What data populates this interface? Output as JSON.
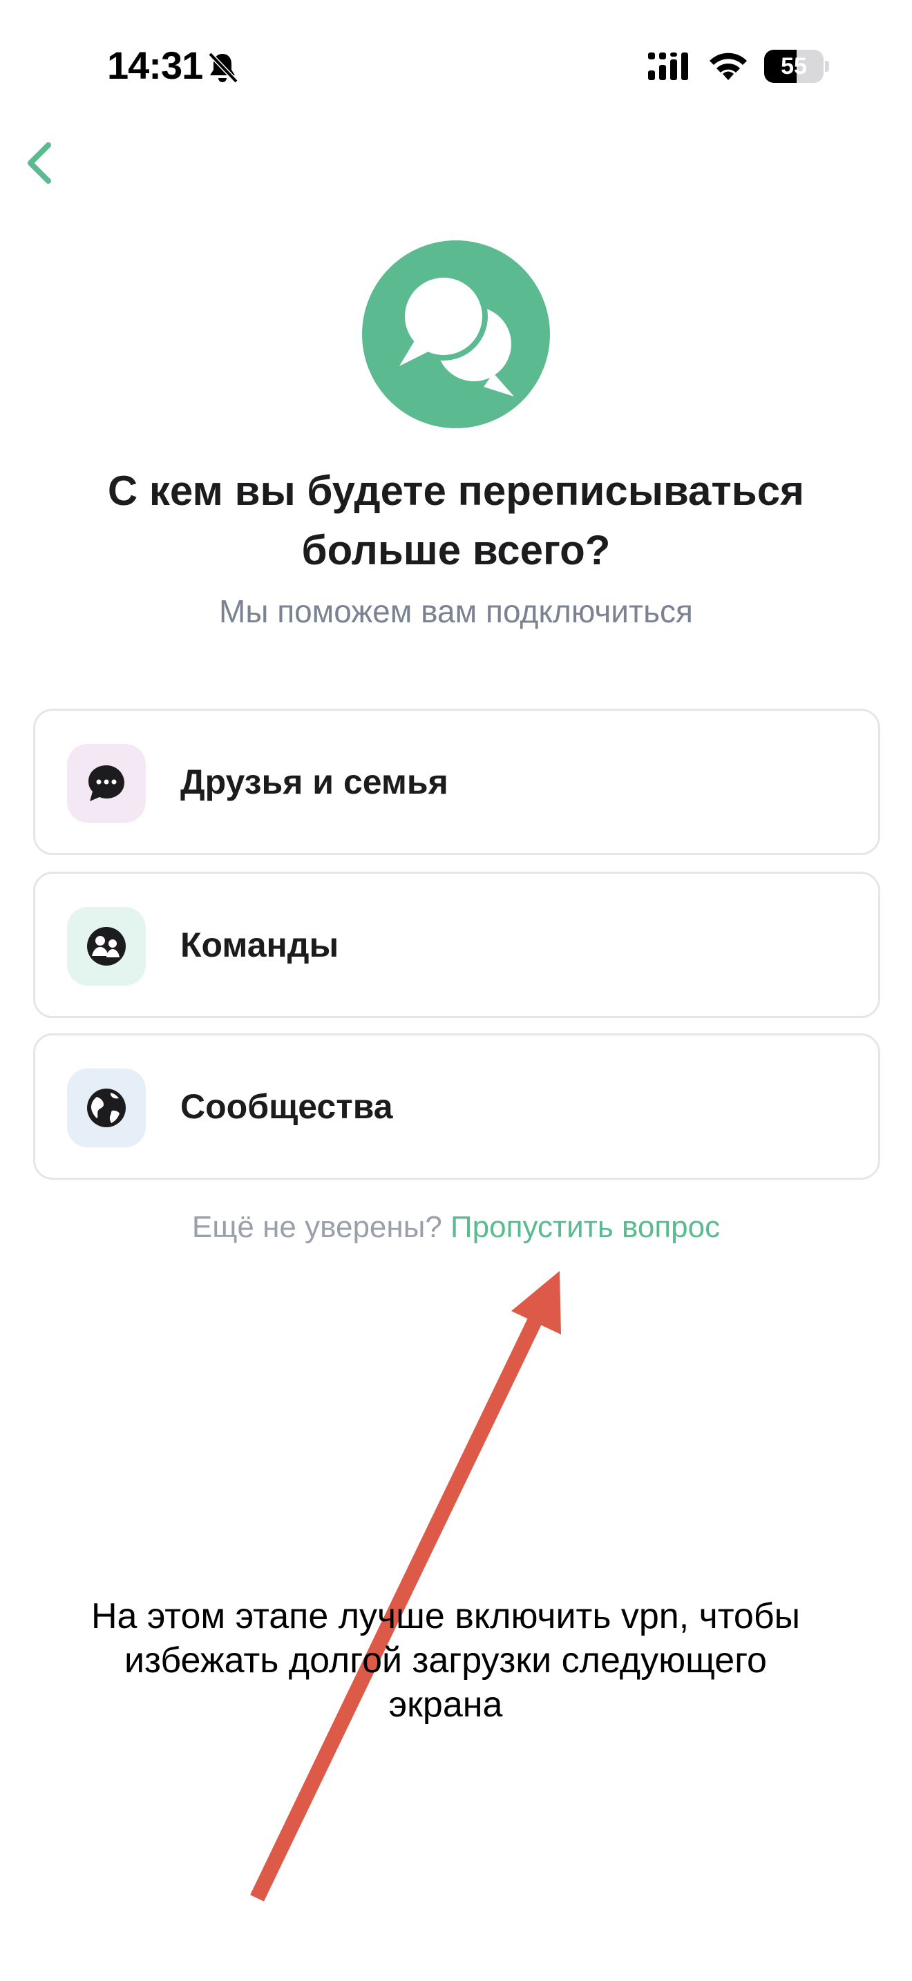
{
  "status": {
    "time": "14:31",
    "battery_level": "55",
    "battery_fraction": 0.55
  },
  "header": {
    "back_icon": "chevron-left-icon"
  },
  "hero": {
    "icon": "chat-bubbles-icon",
    "title": "С кем вы будете переписываться больше всего?",
    "subtitle": "Мы поможем вам подключиться"
  },
  "options": [
    {
      "label": "Друзья и семья",
      "icon": "chat-dots-icon",
      "icon_bg": "#f4e8f4"
    },
    {
      "label": "Команды",
      "icon": "people-icon",
      "icon_bg": "#e3f5ee"
    },
    {
      "label": "Сообщества",
      "icon": "globe-icon",
      "icon_bg": "#e6eef8"
    }
  ],
  "skip": {
    "prompt": "Ещё не уверены?",
    "link": "Пропустить вопрос"
  },
  "annotation": {
    "text": "На этом этапе лучше включить vpn, чтобы избежать долгой загрузки следующего экрана"
  },
  "colors": {
    "accent": "#5bba8f",
    "arrow": "#dc5a47",
    "text_primary": "#1c1c1e",
    "text_secondary": "#7b8291"
  }
}
